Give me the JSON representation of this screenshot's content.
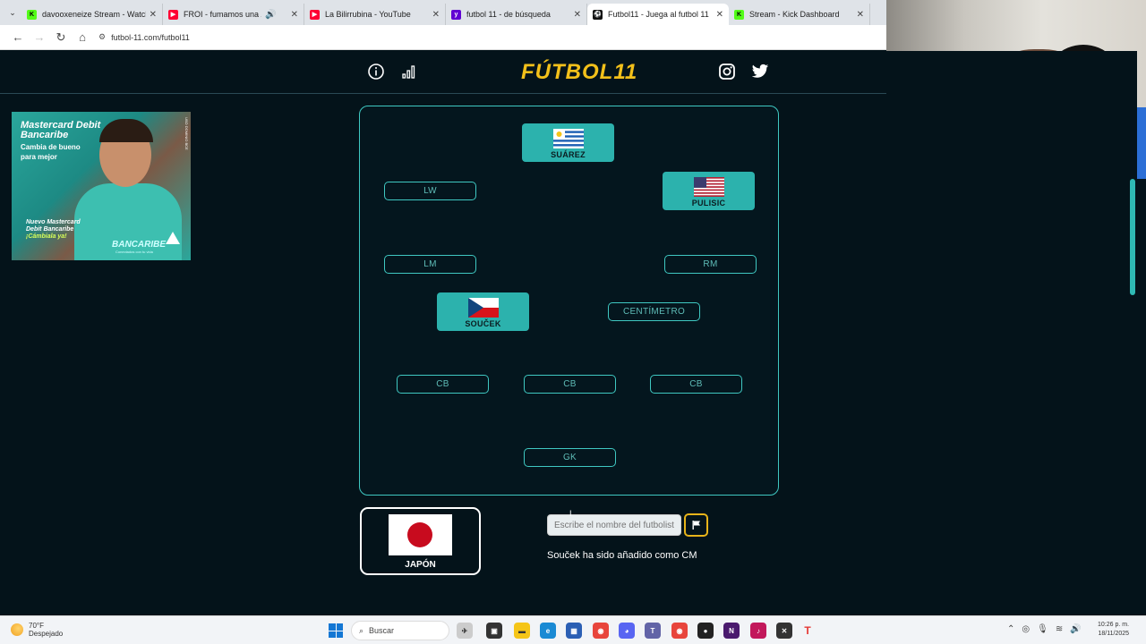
{
  "browser": {
    "tabs": [
      {
        "title": "davooxeneize Stream - Watch L",
        "icon_color": "#53fc18",
        "icon": "K"
      },
      {
        "title": "FROI - fumamos una ZAZA",
        "icon_color": "#ff0033",
        "icon": "▶"
      },
      {
        "title": "La Bilirrubina - YouTube",
        "icon_color": "#ff0033",
        "icon": "▶"
      },
      {
        "title": "futbol 11 - de búsqueda",
        "icon_color": "#6001d2",
        "icon": "y"
      },
      {
        "title": "Futbol11 - Juega al futbol 11",
        "icon_color": "#111111",
        "icon": "⚽",
        "active": true
      },
      {
        "title": "Stream - Kick Dashboard",
        "icon_color": "#53fc18",
        "icon": "K"
      }
    ],
    "url": "futbol-11.com/futbol11"
  },
  "site": {
    "logo": "FÚTBOL11",
    "logo_color": "#f3c01a",
    "accent": "#3fc8c2"
  },
  "ad": {
    "title": "Mastercard Debit Bancaribe",
    "subtitle": "Cambia de bueno para mejor",
    "promo_line1": "Nuevo Mastercard Debit Bancaribe",
    "promo_line2": "¡Cámbiala ya!",
    "brand": "BANCARIBE",
    "brand_tagline": "Conectados con tu vida",
    "side_text": "USO DOMINIO BCE"
  },
  "pitch": {
    "players": [
      {
        "id": "st",
        "name": "SUÁREZ",
        "flag": "uruguay"
      },
      {
        "id": "rw",
        "name": "PULISIC",
        "flag": "usa"
      },
      {
        "id": "cm",
        "name": "SOUČEK",
        "flag": "czech"
      }
    ],
    "slots": {
      "lw": "LW",
      "lm": "LM",
      "rm": "RM",
      "cm2": "CENTÍMETRO",
      "cb1": "CB",
      "cb2": "CB",
      "cb3": "CB",
      "gk": "GK"
    }
  },
  "challenge": {
    "nation": "JAPÓN",
    "search_placeholder": "Escribe el nombre del futbolista",
    "message": "Souček ha sido añadido como CM"
  },
  "taskbar": {
    "weather_temp": "70°F",
    "weather_desc": "Despejado",
    "search": "Buscar",
    "time": "10:26 p. m.",
    "date": "18/11/2025"
  }
}
